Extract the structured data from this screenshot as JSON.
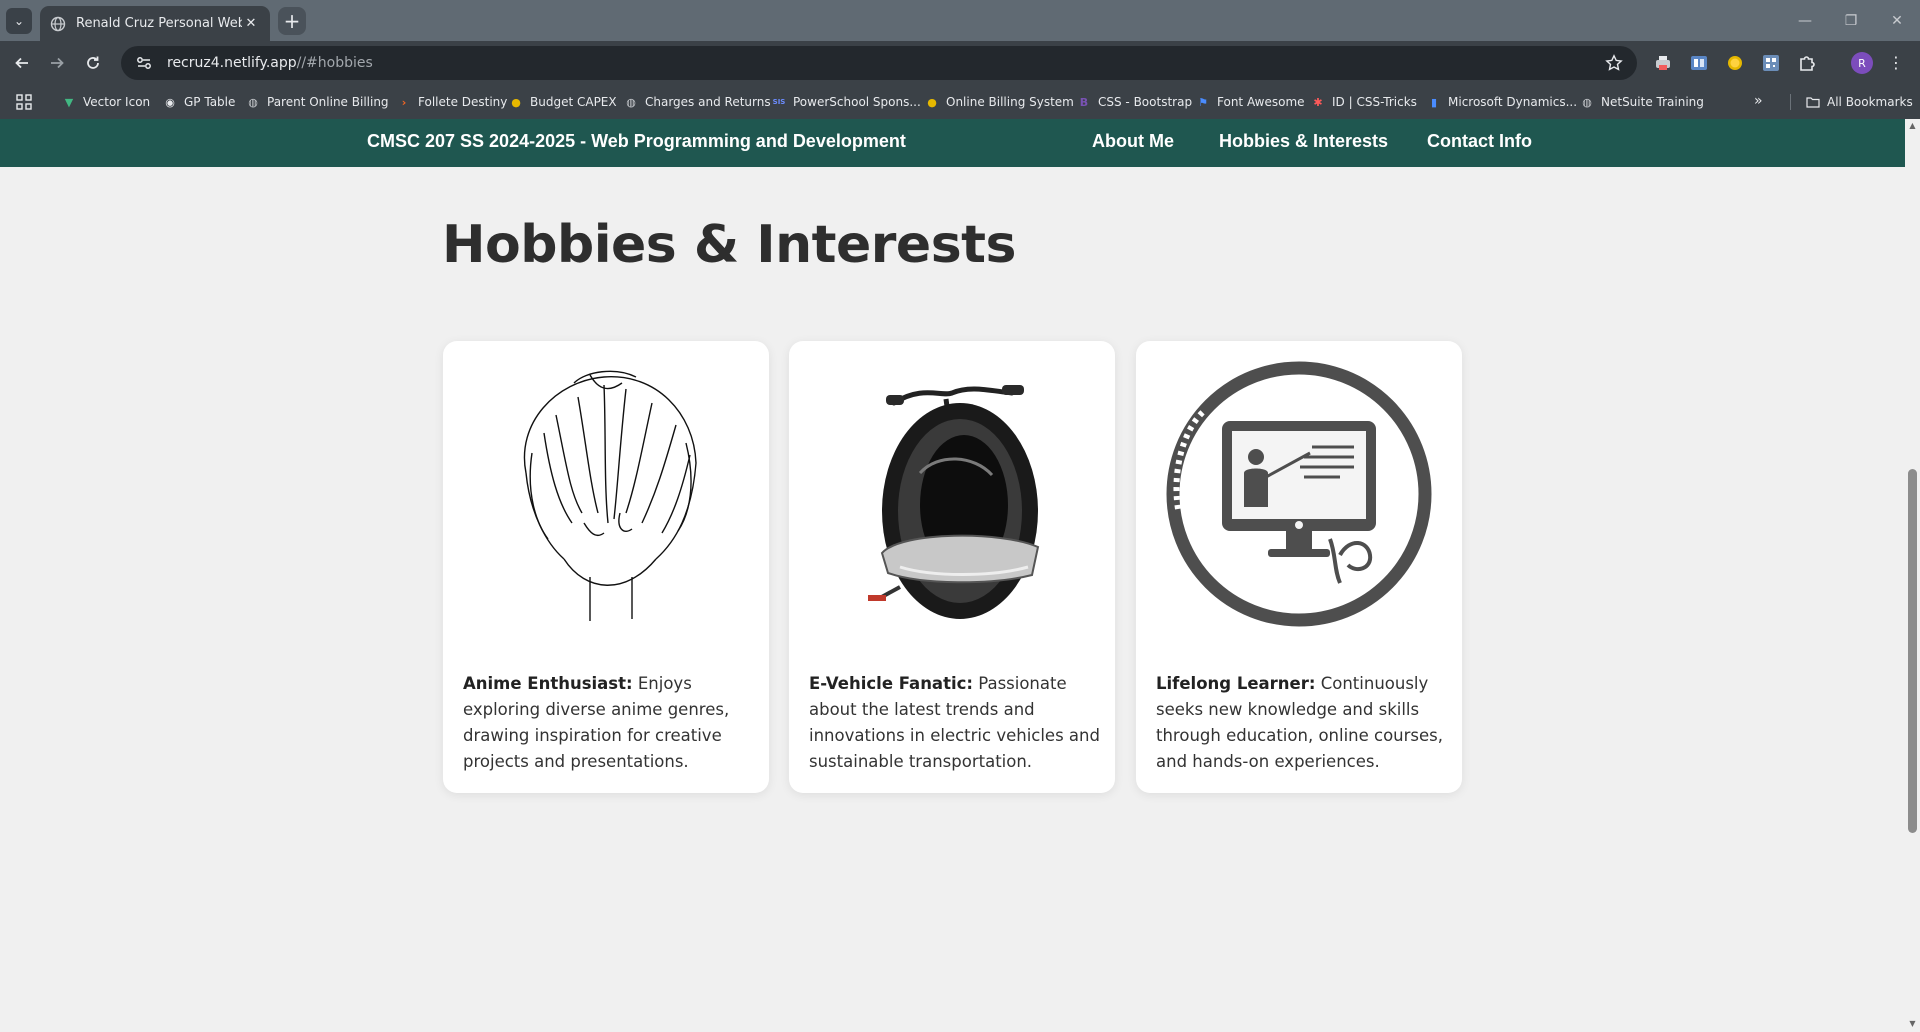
{
  "browser": {
    "tab_title": "Renald Cruz Personal Web Profile",
    "tab_close": "✕",
    "new_tab": "+",
    "url_host": "recruz4.netlify.app",
    "url_path": "//#hobbies",
    "avatar_letter": "R",
    "window_controls": {
      "minimize": "—",
      "maximize": "❐",
      "close": "✕"
    }
  },
  "bookmarks": [
    {
      "label": "Vector Icon",
      "icon": "vector-icon",
      "color": "#41b883"
    },
    {
      "label": "GP Table",
      "icon": "gp-table-icon",
      "color": "#e8eaed"
    },
    {
      "label": "Parent Online Billing",
      "icon": "globe-icon",
      "color": "#c9ccd0"
    },
    {
      "label": "Follete Destiny",
      "icon": "follett-icon",
      "color": "#f26522"
    },
    {
      "label": "Budget CAPEX",
      "icon": "coin-icon",
      "color": "#e6b800"
    },
    {
      "label": "Charges and Returns",
      "icon": "globe-icon",
      "color": "#c9ccd0"
    },
    {
      "label": "PowerSchool Spons...",
      "icon": "sis-icon",
      "color": "#6c8cff"
    },
    {
      "label": "Online Billing System",
      "icon": "coin-icon",
      "color": "#e6b800"
    },
    {
      "label": "CSS - Bootstrap",
      "icon": "bootstrap-icon",
      "color": "#7952b3"
    },
    {
      "label": "Font Awesome",
      "icon": "flag-icon",
      "color": "#4a8cff"
    },
    {
      "label": "ID | CSS-Tricks",
      "icon": "asterisk-icon",
      "color": "#ff5a5a"
    },
    {
      "label": "Microsoft Dynamics...",
      "icon": "chart-icon",
      "color": "#4a8cff"
    },
    {
      "label": "NetSuite Training",
      "icon": "globe-icon",
      "color": "#c9ccd0"
    }
  ],
  "bookmarks_more": "»",
  "all_bookmarks": "All Bookmarks",
  "site": {
    "brand": "CMSC 207 SS 2024-2025 - Web Programming and Development",
    "nav": [
      "About Me",
      "Hobbies & Interests",
      "Contact Info"
    ]
  },
  "section": {
    "title": "Hobbies & Interests",
    "cards": [
      {
        "heading": "Anime Enthusiast:",
        "text": " Enjoys exploring diverse anime genres, drawing inspiration for creative projects and presentations.",
        "image": "anime-hair-sketch"
      },
      {
        "heading": "E-Vehicle Fanatic:",
        "text": " Passionate about the latest trends and innovations in electric vehicles and sustainable transportation.",
        "image": "electric-unicycle"
      },
      {
        "heading": "Lifelong Learner:",
        "text": " Continuously seeks new knowledge and skills through education, online courses, and hands-on experiences.",
        "image": "online-learning-icon"
      }
    ]
  },
  "colors": {
    "nav_bg": "#1f5750",
    "page_bg": "#f0f0f0",
    "text": "#2e2e2e"
  }
}
